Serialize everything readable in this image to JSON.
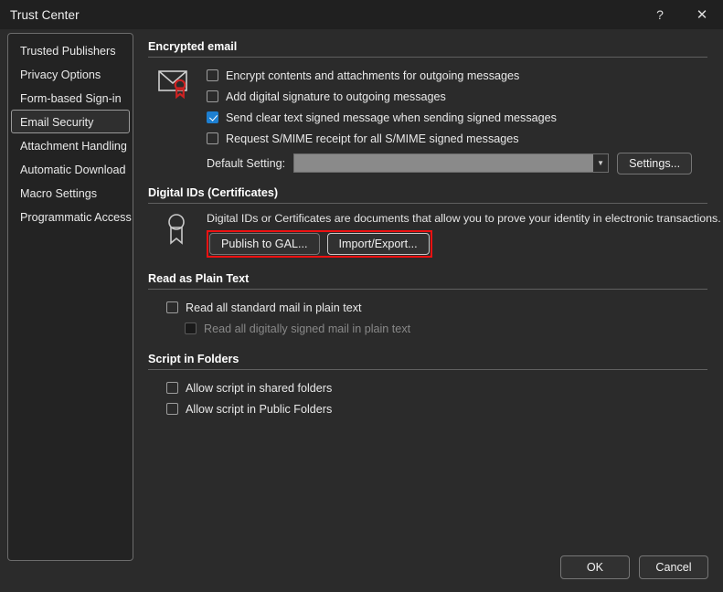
{
  "window": {
    "title": "Trust Center",
    "help_label": "?",
    "close_label": "✕"
  },
  "sidebar": {
    "items": [
      {
        "label": "Trusted Publishers",
        "selected": false
      },
      {
        "label": "Privacy Options",
        "selected": false
      },
      {
        "label": "Form-based Sign-in",
        "selected": false
      },
      {
        "label": "Email Security",
        "selected": true
      },
      {
        "label": "Attachment Handling",
        "selected": false
      },
      {
        "label": "Automatic Download",
        "selected": false
      },
      {
        "label": "Macro Settings",
        "selected": false
      },
      {
        "label": "Programmatic Access",
        "selected": false
      }
    ]
  },
  "sections": {
    "encrypted_email": {
      "heading": "Encrypted email",
      "checkboxes": [
        {
          "label": "Encrypt contents and attachments for outgoing messages",
          "checked": false,
          "disabled": false
        },
        {
          "label": "Add digital signature to outgoing messages",
          "checked": false,
          "disabled": false
        },
        {
          "label": "Send clear text signed message when sending signed messages",
          "checked": true,
          "disabled": false
        },
        {
          "label": "Request S/MIME receipt for all S/MIME signed messages",
          "checked": false,
          "disabled": false
        }
      ],
      "default_setting_label": "Default Setting:",
      "default_setting_value": "",
      "settings_button": "Settings..."
    },
    "digital_ids": {
      "heading": "Digital IDs (Certificates)",
      "description": "Digital IDs or Certificates are documents that allow you to prove your identity in electronic transactions.",
      "publish_button": "Publish to GAL...",
      "import_export_button": "Import/Export...",
      "highlight_color": "#ee1111"
    },
    "read_plain_text": {
      "heading": "Read as Plain Text",
      "checkboxes": [
        {
          "label": "Read all standard mail in plain text",
          "checked": false,
          "disabled": false,
          "indent": false
        },
        {
          "label": "Read all digitally signed mail in plain text",
          "checked": false,
          "disabled": true,
          "indent": true
        }
      ]
    },
    "script_in_folders": {
      "heading": "Script in Folders",
      "checkboxes": [
        {
          "label": "Allow script in shared folders",
          "checked": false,
          "disabled": false
        },
        {
          "label": "Allow script in Public Folders",
          "checked": false,
          "disabled": false
        }
      ]
    }
  },
  "footer": {
    "ok_label": "OK",
    "cancel_label": "Cancel"
  },
  "icons": {
    "envelope_certificate": "envelope-certificate-icon",
    "certificate_ribbon": "certificate-ribbon-icon"
  },
  "colors": {
    "background": "#2b2b2b",
    "titlebar": "#202020",
    "accent_check": "#1d7fd1",
    "highlight": "#ee1111"
  }
}
